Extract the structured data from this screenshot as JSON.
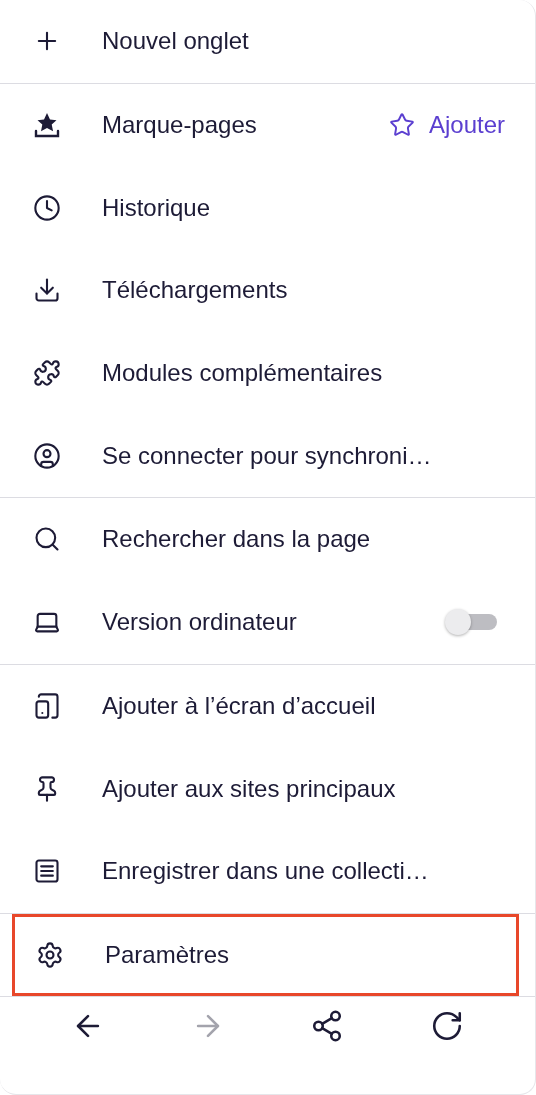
{
  "menu": {
    "sections": [
      {
        "items": [
          {
            "label": "Nouvel onglet",
            "selected": false
          }
        ]
      },
      {
        "items": [
          {
            "label": "Marque-pages",
            "selected": false,
            "action": "Ajouter"
          },
          {
            "label": "Historique",
            "selected": false
          },
          {
            "label": "Téléchargements",
            "selected": false
          },
          {
            "label": "Modules complémentaires",
            "selected": false
          },
          {
            "label": "Se connecter pour synchroni…",
            "selected": false
          }
        ]
      },
      {
        "items": [
          {
            "label": "Rechercher dans la page",
            "selected": false
          },
          {
            "label": "Version ordinateur",
            "selected": false,
            "toggle": {
              "on": false
            }
          }
        ]
      },
      {
        "items": [
          {
            "label": "Ajouter à l’écran d’accueil",
            "selected": false
          },
          {
            "label": "Ajouter aux sites principaux",
            "selected": false
          },
          {
            "label": "Enregistrer dans une collecti…",
            "selected": false
          }
        ]
      },
      {
        "items": [
          {
            "label": "Paramètres",
            "selected": true
          }
        ]
      }
    ]
  },
  "nav": [
    {
      "disabled": false
    },
    {
      "disabled": true
    },
    {
      "disabled": false
    },
    {
      "disabled": false
    }
  ]
}
